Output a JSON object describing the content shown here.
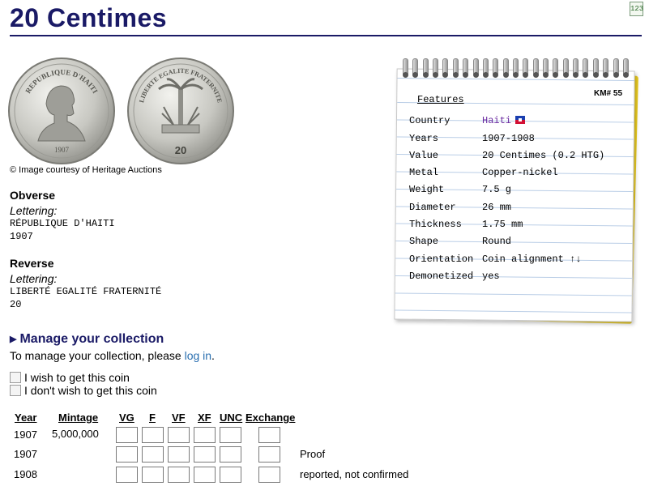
{
  "title": "20 Centimes",
  "credit": "© Image courtesy of Heritage Auctions",
  "obverse": {
    "heading": "Obverse",
    "lettering_label": "Lettering:",
    "lines": [
      "RÉPUBLIQUE D'HAITI",
      "1907"
    ],
    "coin_legend": "REPUBLIQUE D'HAITI",
    "coin_year": "1907"
  },
  "reverse": {
    "heading": "Reverse",
    "lettering_label": "Lettering:",
    "lines": [
      "LIBERTÉ EGALITÉ FRATERNITÉ",
      "20"
    ],
    "coin_legend": "LIBERTE EGALITE FRATERNITE",
    "coin_value": "20"
  },
  "collection": {
    "heading": "Manage your collection",
    "text": "To manage your collection, please",
    "login_link": "log in",
    "text_end": ".",
    "want": "I wish to get this coin",
    "dont_want": "I don't wish to get this coin"
  },
  "grades_table": {
    "headers": [
      "Year",
      "Mintage",
      "VG",
      "F",
      "VF",
      "XF",
      "UNC",
      "Exchange"
    ],
    "rows": [
      {
        "year": "1907",
        "mintage": "5,000,000",
        "note": ""
      },
      {
        "year": "1907",
        "mintage": "",
        "note": "Proof"
      },
      {
        "year": "1908",
        "mintage": "",
        "note": "reported, not confirmed"
      }
    ]
  },
  "features": {
    "heading": "Features",
    "km": "KM# 55",
    "rows": [
      {
        "label": "Country",
        "value": "Haiti",
        "link": true,
        "flag": true
      },
      {
        "label": "Years",
        "value": "1907-1908"
      },
      {
        "label": "Value",
        "value": "20 Centimes (0.2 HTG)"
      },
      {
        "label": "Metal",
        "value": "Copper-nickel"
      },
      {
        "label": "Weight",
        "value": "7.5 g"
      },
      {
        "label": "Diameter",
        "value": "26 mm"
      },
      {
        "label": "Thickness",
        "value": "1.75 mm"
      },
      {
        "label": "Shape",
        "value": "Round"
      },
      {
        "label": "Orientation",
        "value": "Coin alignment ↑↓"
      },
      {
        "label": "Demonetized",
        "value": "yes"
      }
    ]
  },
  "icons": {
    "corner": "numbered-list-icon",
    "flag": "haiti-flag-icon",
    "section_arrow": "triangle-right-icon"
  },
  "colors": {
    "title": "#1a1a66",
    "link": "#2a6fb0",
    "country_link": "#6a2aa0",
    "notebook_backing": "#f0d020"
  }
}
